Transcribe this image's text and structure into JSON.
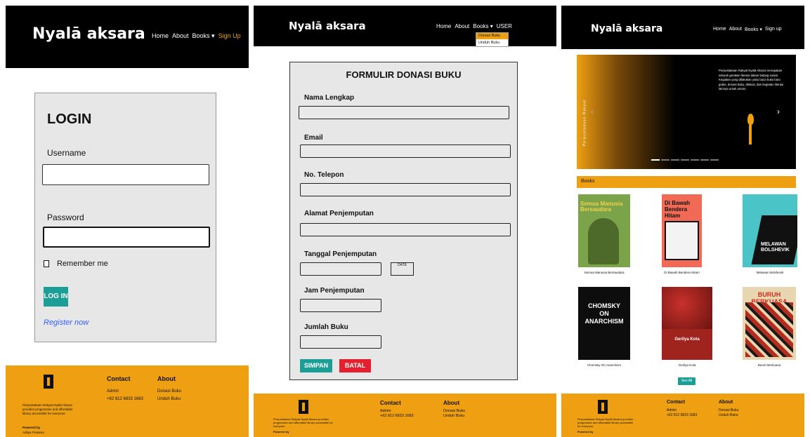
{
  "brand": "Nyalā aksara",
  "nav": {
    "home": "Home",
    "about": "About",
    "books": "Books ▾",
    "signup": "Sign Up",
    "signup_alt": "Sign up",
    "user": "USER",
    "dropdown": [
      "Donasi Buku",
      "Unduh Buku"
    ]
  },
  "login": {
    "title": "LOGIN",
    "username_label": "Username",
    "password_label": "Password",
    "remember": "Remember me",
    "login_button": "LOG IN",
    "register": "Register now"
  },
  "donation": {
    "title": "FORMULIR DONASI BUKU",
    "fields": [
      "Nama Lengkap",
      "Email",
      "No. Telepon",
      "Alamat Penjemputan",
      "Tanggal Penjemputan",
      "Jam Penjemputan",
      "Jumlah Buku"
    ],
    "date_button": "DATE",
    "save": "SIMPAN",
    "cancel": "BATAL"
  },
  "home": {
    "hero_text": "Perpustakaan Rakyat Nyalā Aksara merupakan sebuah gerakan literasi dalam bidang sosial. Kegiatan yang dilakukan yaitu baca buku baru gratis, donasi buku, diskusi, dan kegiatan literasi lainnya untuk umum.",
    "hero_vertical": "Perpustakaan Rakyat",
    "books_header": "Books",
    "books": [
      {
        "title": "Semua Manusia Bersaudara",
        "caption": "Semua Manusia Bersaudara"
      },
      {
        "title": "Di Bawah Bendera Hitam",
        "caption": "Di Bawah Bendera Hitam"
      },
      {
        "title": "MELAWAN BOLSHEVIK",
        "caption": "Melawan Bolshevik"
      },
      {
        "title": "CHOMSKY ON ANARCHISM",
        "caption": "Chomsky On Anarchism"
      },
      {
        "title": "Gerilya Kota",
        "caption": "Gerilya Kota"
      },
      {
        "title": "BURUH BERKUASA",
        "caption": "Buruh Berkuasa"
      }
    ],
    "see_all": "See All"
  },
  "footer": {
    "desc": "Perpustakaan Rakyat Nyalā Aksara provides progressive and affordable library accessible for everyone",
    "powered": "Powered by",
    "powered_by": "Aditya Pratama",
    "contact_head": "Contact",
    "contact_admin": "Admin",
    "contact_phone": "+62 812 6833 1683",
    "about_head": "About",
    "about_links": [
      "Donasi Buku",
      "Unduh Buku"
    ]
  },
  "colors": {
    "accent": "#eea012",
    "teal": "#1a9e95",
    "red": "#e5202e",
    "link": "#3060ff"
  }
}
